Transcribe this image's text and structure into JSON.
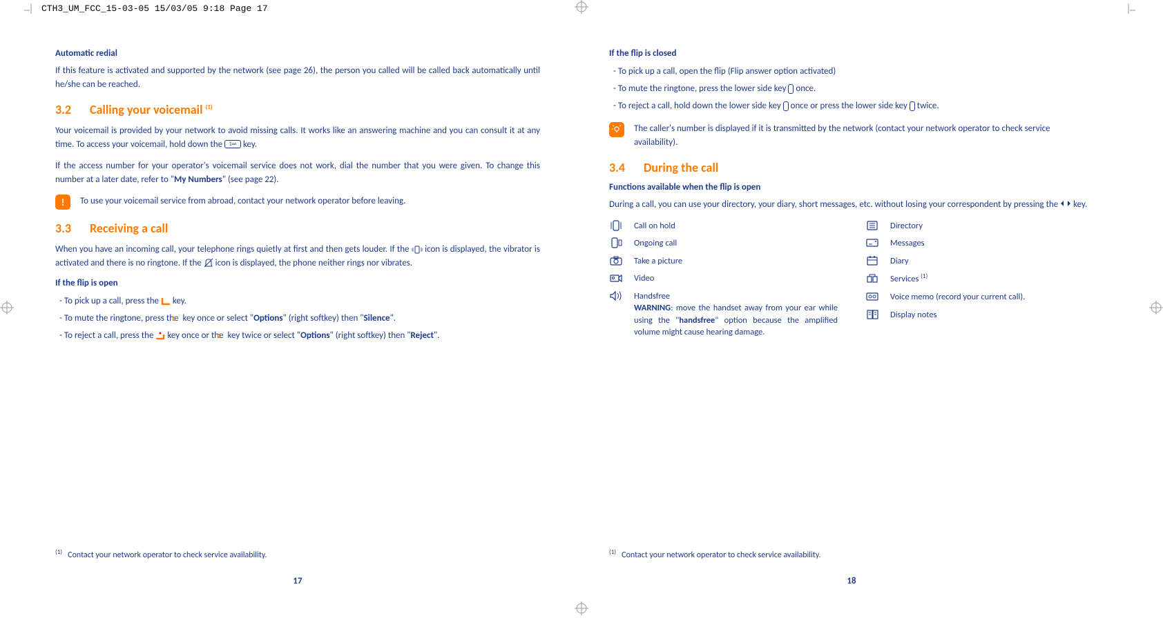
{
  "header": "CTH3_UM_FCC_15-03-05  15/03/05  9:18  Page 17",
  "left": {
    "autoRedial": {
      "title": "Automatic redial",
      "body": "If this feature is activated and supported by the network (see page 26), the person you called will be called back automatically until he/she can be reached."
    },
    "sec32": {
      "num": "3.2",
      "title": "Calling your voicemail ",
      "sup": "(1)",
      "p1a": "Your voicemail is provided by your network to avoid missing calls. It works like an answering machine and you can consult it at any time. To access your voicemail, hold down the ",
      "p1b": " key.",
      "p2a": "If the access number for your operator's voicemail service does not work, dial the number that you were given. To change this number at a later date, refer to \"",
      "p2b": "My Numbers",
      "p2c": "\" (see page 22).",
      "note": "To use your voicemail service from abroad, contact your network operator before leaving."
    },
    "sec33": {
      "num": "3.3",
      "title": "Receiving a call",
      "p1a": "When you have an incoming call, your telephone rings quietly at first and then gets louder. If the ",
      "p1b": " icon is displayed, the vibrator is activated and there is no ringtone. If the ",
      "p1c": " icon is displayed, the phone neither rings nor vibrates.",
      "openTitle": "If the flip is open",
      "b1a": "To pick up a call, press the ",
      "b1b": " key.",
      "b2a": "To mute the ringtone, press the ",
      "b2b": " key once or select \"",
      "b2c": "Options",
      "b2d": "\" (right softkey) then \"",
      "b2e": "Silence",
      "b2f": "\".",
      "b3a": "To reject a call, press the ",
      "b3b": " key once or the ",
      "b3c": " key twice or select \"",
      "b3d": "Options",
      "b3e": "\" (right softkey) then \"",
      "b3f": "Reject",
      "b3g": "\"."
    },
    "footnote": "Contact your network operator to check service availability.",
    "footnoteSup": "(1)",
    "pageNum": "17"
  },
  "right": {
    "closedTitle": "If the flip is closed",
    "c1": "To pick up a call, open the flip (Flip answer option activated)",
    "c2a": "To mute the ringtone, press the lower side key ",
    "c2b": " once.",
    "c3a": "To reject a call, hold down the lower side key ",
    "c3b": " once or press the lower side key ",
    "c3c": " twice.",
    "tip": "The caller's number is displayed if it is transmitted by the network (contact your network operator to check service availability).",
    "sec34": {
      "num": "3.4",
      "title": "During the call",
      "subTitle": "Functions available when the flip is open",
      "p1a": "During a call, you can use your directory, your diary, short messages, etc. without losing your correspondent by pressing the ",
      "p1b": " key."
    },
    "functions": {
      "col1": [
        {
          "label": "Call on hold"
        },
        {
          "label": "Ongoing call"
        },
        {
          "label": "Take a picture"
        },
        {
          "label": "Video"
        },
        {
          "label": "Handsfree",
          "warning": "WARNING",
          "warningText": ": move the handset away from your ear while using the \"",
          "warningBold": "handsfree",
          "warningEnd": "\" option because the amplified volume might cause hearing damage."
        }
      ],
      "col2": [
        {
          "label": "Directory"
        },
        {
          "label": "Messages"
        },
        {
          "label": "Diary"
        },
        {
          "label": "Services ",
          "sup": "(1)"
        },
        {
          "label": "Voice memo (record your current call)."
        },
        {
          "label": "Display notes"
        }
      ]
    },
    "footnote": "Contact your network operator to check service availability.",
    "footnoteSup": "(1)",
    "pageNum": "18"
  }
}
